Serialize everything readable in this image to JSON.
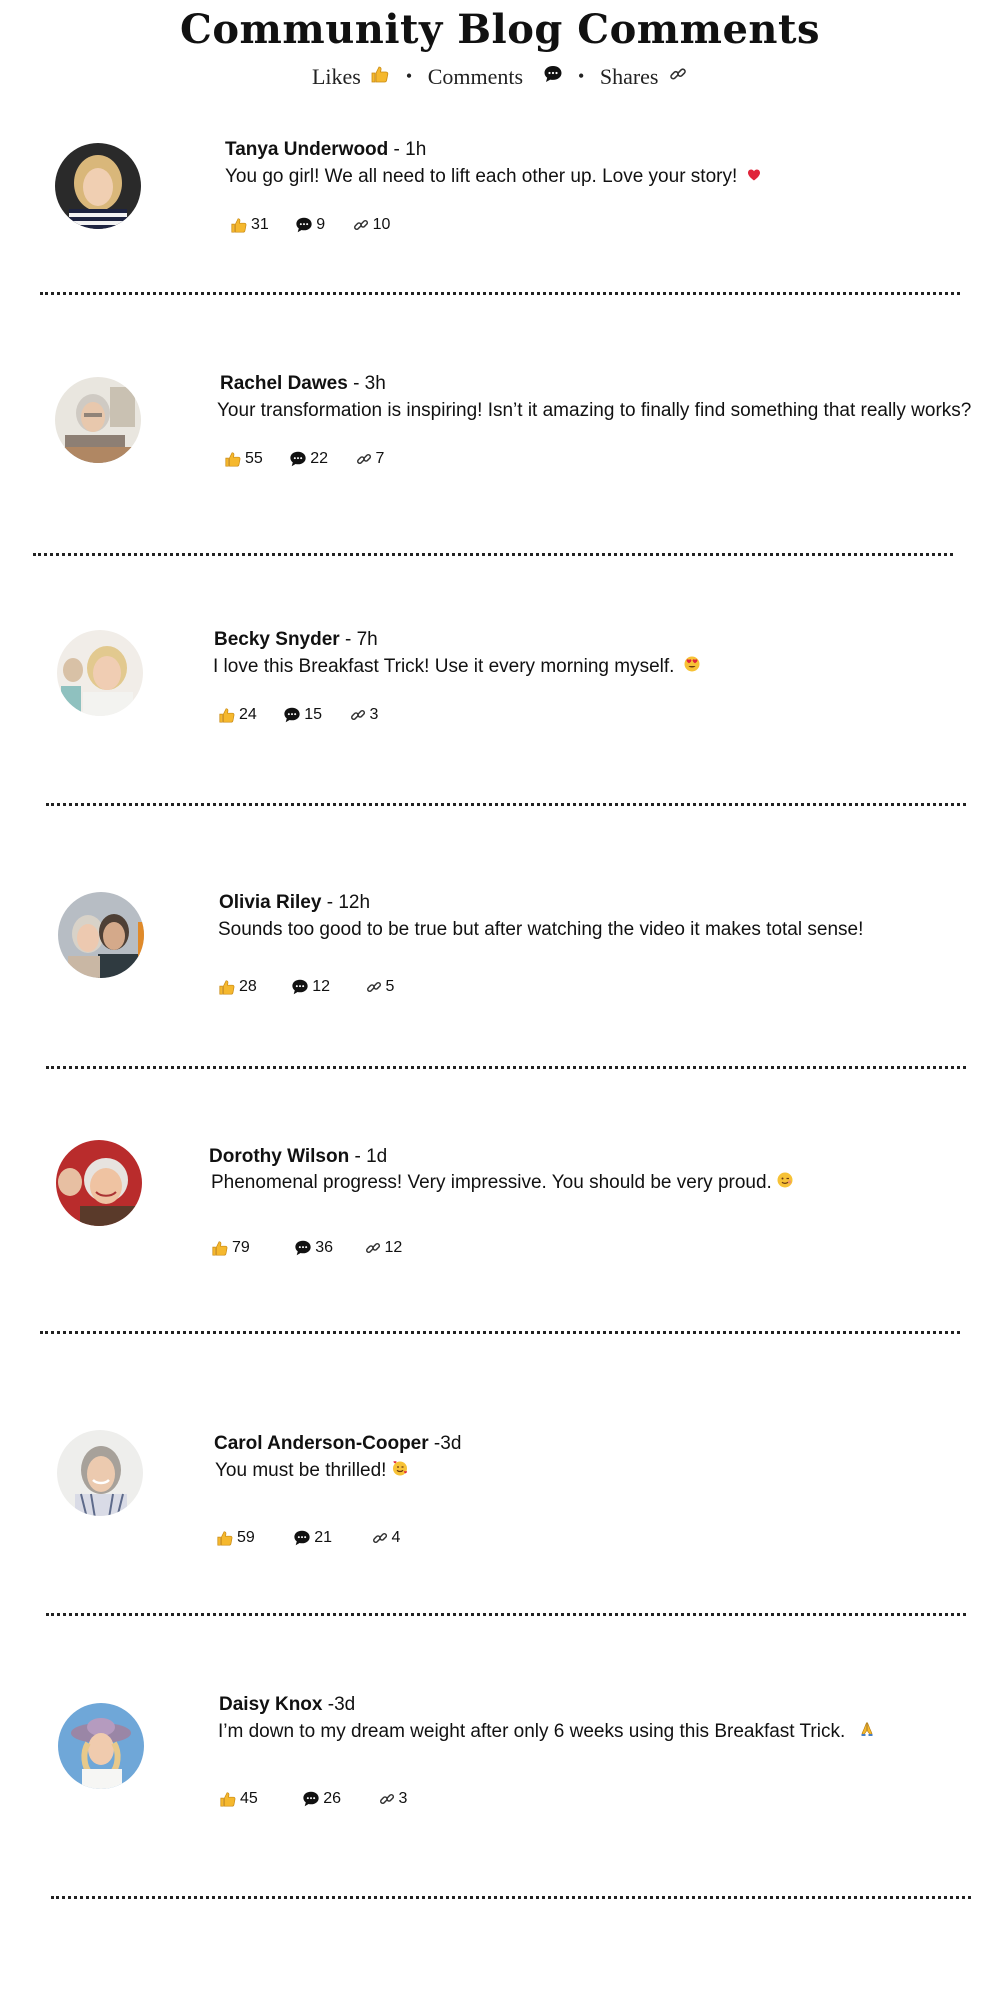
{
  "page": {
    "title": "Community Blog Comments",
    "subtitle": {
      "likes_label": "Likes",
      "comments_label": "Comments",
      "shares_label": "Shares"
    }
  },
  "icons": {
    "like": "thumbs-up-icon",
    "comment": "speech-bubble-icon",
    "share": "link-icon"
  },
  "comments": [
    {
      "name": "Tanya Underwood",
      "time": " - 1h",
      "text": "You go girl!  We all need to lift each other up.  Love your story!",
      "emoji": "heart",
      "likes": "31",
      "comments": "9",
      "shares": "10"
    },
    {
      "name": "Rachel Dawes",
      "time": " - 3h",
      "text": "Your transformation is inspiring! Isn’t it amazing to finally find something that really works?",
      "emoji": "",
      "likes": "55",
      "comments": "22",
      "shares": "7"
    },
    {
      "name": "Becky Snyder",
      "time": " - 7h",
      "text": "I love this Breakfast Trick!  Use it every morning myself.",
      "emoji": "heart-eyes",
      "likes": "24",
      "comments": "15",
      "shares": "3"
    },
    {
      "name": "Olivia Riley",
      "time": " - 12h",
      "text": "Sounds too good to be true but after watching the video it makes total sense!",
      "emoji": "",
      "likes": "28",
      "comments": "12",
      "shares": "5"
    },
    {
      "name": "Dorothy Wilson",
      "time": " - 1d",
      "text": "Phenomenal progress! Very impressive. You should be very proud.",
      "emoji": "wink",
      "likes": "79",
      "comments": "36",
      "shares": "12"
    },
    {
      "name": "Carol Anderson-Cooper",
      "time": " -3d",
      "text": "You must be thrilled!",
      "emoji": "smiling-hearts",
      "likes": "59",
      "comments": "21",
      "shares": "4"
    },
    {
      "name": "Daisy Knox",
      "time": " -3d",
      "text": "I’m down to my dream weight after only 6 weeks using this Breakfast Trick.",
      "emoji": "folded-hands",
      "likes": "45",
      "comments": "26",
      "shares": "3"
    }
  ],
  "colors": {
    "thumb": "#F5B82E",
    "heart": "#E0243A",
    "text": "#111111",
    "divider": "#222222"
  }
}
